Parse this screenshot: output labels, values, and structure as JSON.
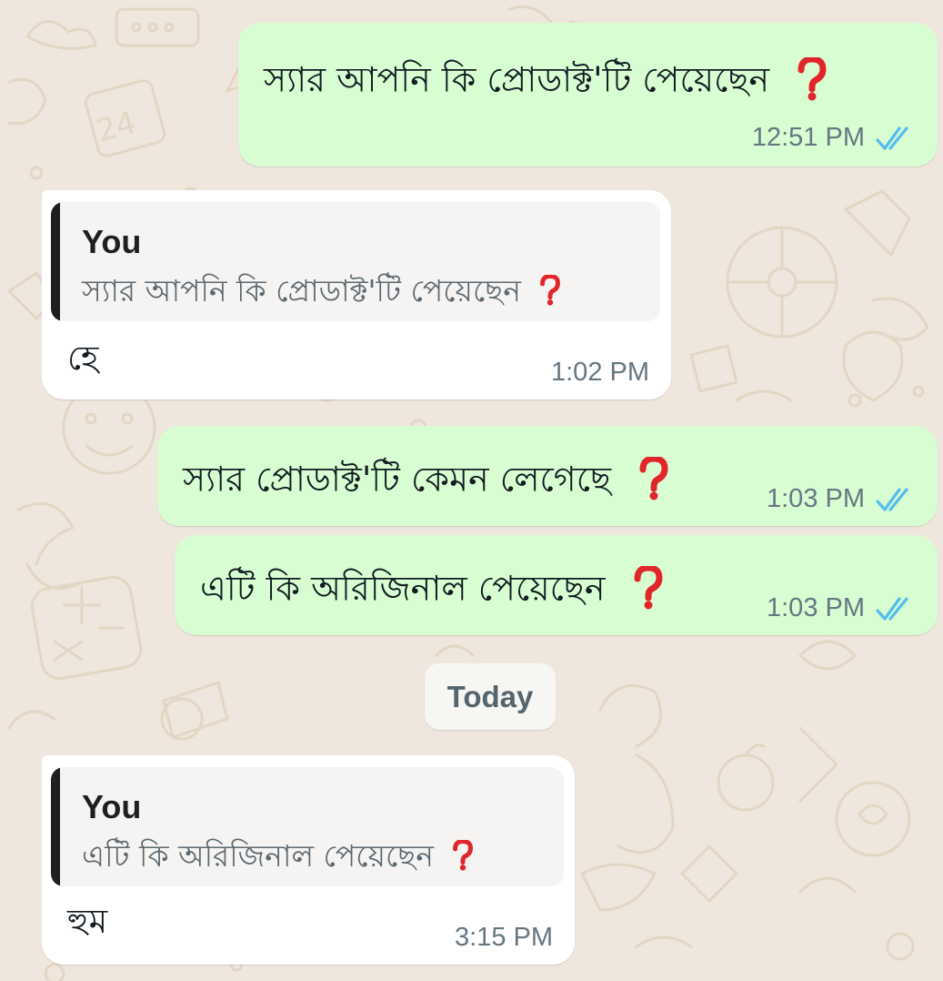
{
  "chat": {
    "date_divider": "Today",
    "messages": [
      {
        "direction": "outgoing",
        "text": "স্যার আপনি কি প্রোডাক্ট'টি পেয়েছেন",
        "emoji": "❓",
        "time": "12:51 PM",
        "status": "read"
      },
      {
        "direction": "incoming",
        "reply_to": {
          "author": "You",
          "text": "স্যার আপনি কি প্রোডাক্ট'টি পেয়েছেন",
          "emoji": "❓"
        },
        "text": "হে",
        "time": "1:02 PM"
      },
      {
        "direction": "outgoing",
        "text": "স্যার প্রোডাক্ট'টি কেমন লেগেছে",
        "emoji": "❓",
        "time": "1:03 PM",
        "status": "read"
      },
      {
        "direction": "outgoing",
        "text": "এটি কি অরিজিনাল পেয়েছেন",
        "emoji": "❓",
        "time": "1:03 PM",
        "status": "read"
      },
      {
        "direction": "incoming",
        "reply_to": {
          "author": "You",
          "text": "এটি কি অরিজিনাল পেয়েছেন",
          "emoji": "❓"
        },
        "text": "হুম",
        "time": "3:15 PM"
      }
    ]
  },
  "icons": {
    "read_receipt": "double-check-icon",
    "question": "red-question-mark-icon"
  },
  "colors": {
    "wallpaper": "#efe7dd",
    "outgoing_bubble": "#d9fdd3",
    "incoming_bubble": "#ffffff",
    "read_tick": "#53bdeb",
    "question_red": "#e0262b",
    "quote_bar": "#1f1f1f"
  }
}
